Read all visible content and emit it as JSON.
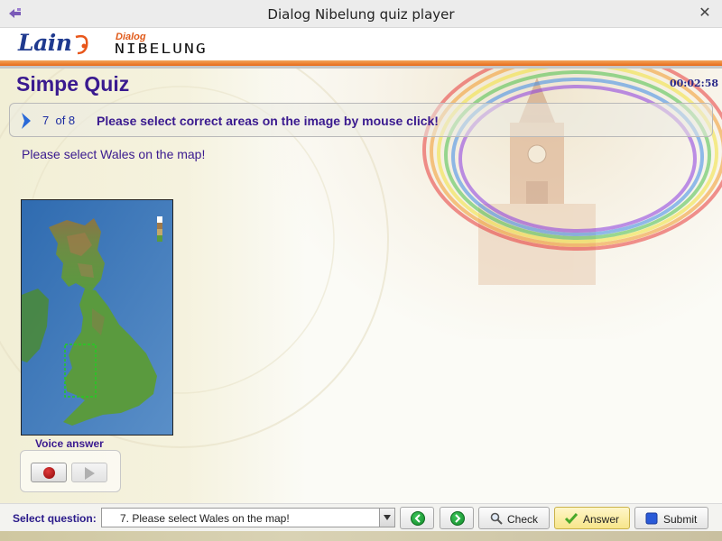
{
  "window": {
    "title": "Dialog Nibelung quiz player",
    "close_symbol": "✕"
  },
  "branding": {
    "logo_left": "Lain",
    "logo_dialog": "Dialog",
    "logo_product": "NIBELUNG"
  },
  "quiz": {
    "title": "Simpe Quiz",
    "timer": "00:02:58"
  },
  "question_bar": {
    "number": "7",
    "of_total": "of 8",
    "prompt": "Please select correct areas on the image by mouse click!"
  },
  "question": {
    "instruction": "Please select Wales on the map!"
  },
  "voice": {
    "label": "Voice answer",
    "record_icon": "record-icon",
    "play_icon": "play-icon"
  },
  "bottom": {
    "select_label": "Select question:",
    "selected_question": "7. Please select Wales on the map!",
    "back_icon": "back-arrow-icon",
    "forward_icon": "forward-arrow-icon",
    "check_label": "Check",
    "answer_label": "Answer",
    "submit_label": "Submit"
  },
  "colors": {
    "accent_purple": "#3a1a8f",
    "accent_orange": "#e86a18",
    "selection_green": "#22cc22"
  }
}
